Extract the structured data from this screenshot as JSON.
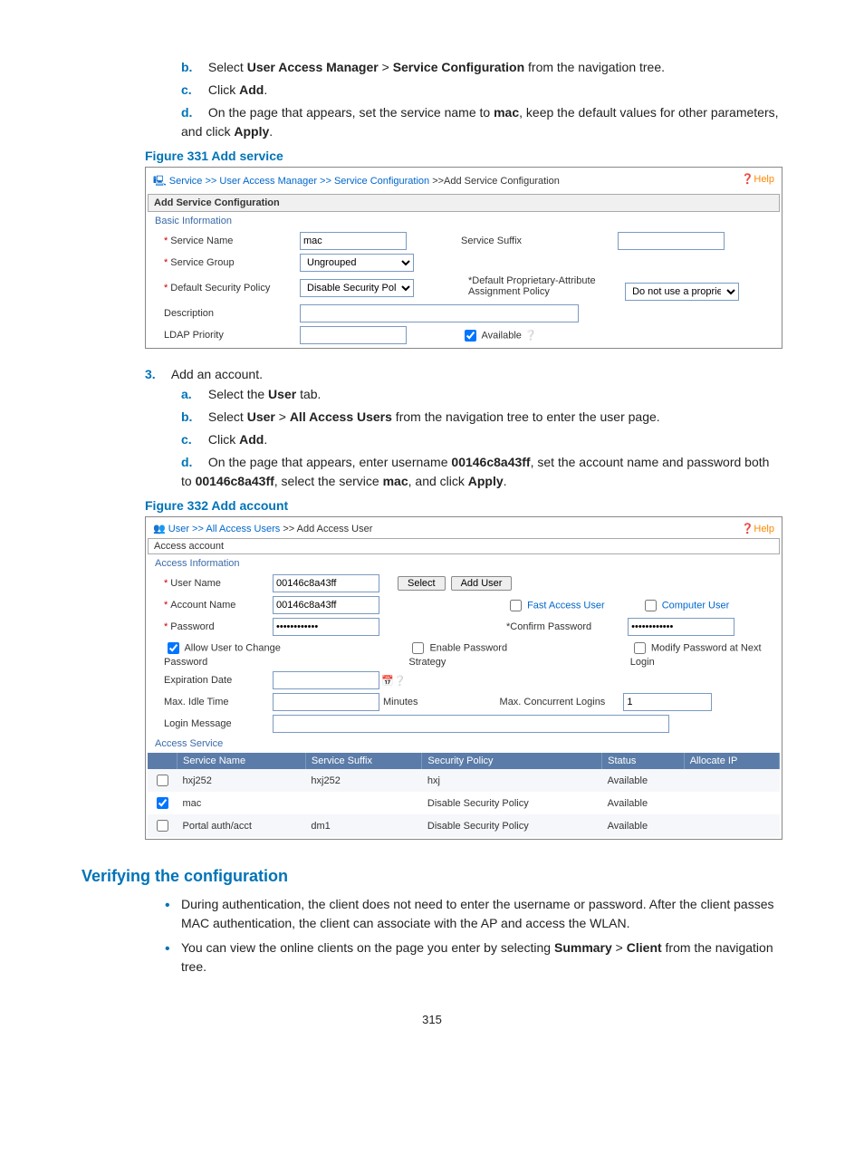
{
  "steps": {
    "b": "Select ",
    "b_bold1": "User Access Manager",
    "b_mid": " > ",
    "b_bold2": "Service Configuration",
    "b_end": " from the navigation tree.",
    "c": "Click ",
    "c_bold": "Add",
    "c_end": ".",
    "d_pre": "On the page that appears, set the service name to ",
    "d_bold1": "mac",
    "d_mid": ", keep the default values for other parameters, and click ",
    "d_bold2": "Apply",
    "d_end": "."
  },
  "fig331": "Figure 331 Add service",
  "panel1": {
    "crumb_service": "Service",
    "crumb_uam": "User Access Manager",
    "crumb_sc": "Service Configuration",
    "crumb_add": ">>Add Service Configuration",
    "help": "Help",
    "section": "Add Service Configuration",
    "basic": "Basic Information",
    "service_name_lab": "Service Name",
    "service_name_val": "mac",
    "service_suffix_lab": "Service Suffix",
    "service_group_lab": "Service Group",
    "service_group_val": "Ungrouped",
    "def_sec_lab": "Default Security Policy",
    "def_sec_val": "Disable Security Policy",
    "def_prop_lab": "Default Proprietary-Attribute Assignment Policy",
    "def_prop_val": "Do not use a proprietar",
    "desc_lab": "Description",
    "ldap_lab": "LDAP Priority",
    "available": "Available"
  },
  "step3": {
    "marker": "3.",
    "text": "Add an account.",
    "a": "Select the ",
    "a_bold": "User",
    "a_end": " tab.",
    "b": "Select ",
    "b_bold1": "User",
    "b_mid": " > ",
    "b_bold2": "All Access Users",
    "b_end": " from the navigation tree to enter the user page.",
    "c": "Click ",
    "c_bold": "Add",
    "c_end": ".",
    "d_pre": "On the page that appears, enter username ",
    "d_bold1": "00146c8a43ff",
    "d_mid1": ", set the account name and password both to ",
    "d_bold2": "00146c8a43ff",
    "d_mid2": ", select the service ",
    "d_bold3": "mac",
    "d_mid3": ", and click ",
    "d_bold4": "Apply",
    "d_end": "."
  },
  "fig332": "Figure 332 Add account",
  "panel2": {
    "crumb_user": "User",
    "crumb_all": "All Access Users",
    "crumb_add": " >> Add Access User",
    "help": "Help",
    "section": "Access account",
    "access_info": "Access Information",
    "user_name_lab": "User Name",
    "user_name_val": "00146c8a43ff",
    "select_btn": "Select",
    "adduser_btn": "Add User",
    "account_name_lab": "Account Name",
    "account_name_val": "00146c8a43ff",
    "fast_access": "Fast Access User",
    "computer_user": "Computer User",
    "password_lab": "Password",
    "password_val": "••••••••••••",
    "confirm_lab": "Confirm Password",
    "confirm_val": "••••••••••••",
    "allow_change": "Allow User to Change Password",
    "enable_strategy": "Enable Password Strategy",
    "modify_next": "Modify Password at Next Login",
    "expiration_lab": "Expiration Date",
    "max_idle_lab": "Max. Idle Time",
    "minutes": "Minutes",
    "max_conc_lab": "Max. Concurrent Logins",
    "max_conc_val": "1",
    "login_msg_lab": "Login Message",
    "access_service": "Access Service",
    "th_service": "Service Name",
    "th_suffix": "Service Suffix",
    "th_policy": "Security Policy",
    "th_status": "Status",
    "th_allocate": "Allocate IP",
    "rows": [
      {
        "checked": false,
        "name": "hxj252",
        "suffix": "hxj252",
        "policy": "hxj",
        "status": "Available"
      },
      {
        "checked": true,
        "name": "mac",
        "suffix": "",
        "policy": "Disable Security Policy",
        "status": "Available"
      },
      {
        "checked": false,
        "name": "Portal auth/acct",
        "suffix": "dm1",
        "policy": "Disable Security Policy",
        "status": "Available"
      }
    ]
  },
  "verify_h": "Verifying the configuration",
  "verify_b1_pre": "During authentication, the client does not need to enter the username or password. After the client passes MAC authentication, the client can associate with the AP and access the WLAN.",
  "verify_b2_pre": "You can view the online clients on the page you enter by selecting ",
  "verify_b2_bold1": "Summary",
  "verify_b2_mid": " > ",
  "verify_b2_bold2": "Client",
  "verify_b2_end": " from the navigation tree.",
  "pagenum": "315"
}
